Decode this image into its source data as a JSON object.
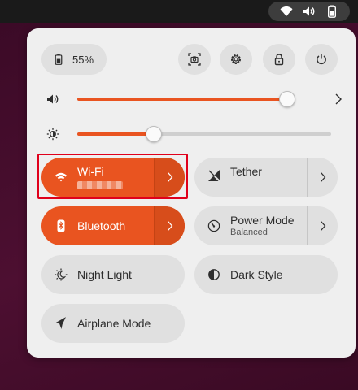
{
  "topbar": {
    "tray_icons": [
      "wifi-icon",
      "volume-icon",
      "battery-icon"
    ]
  },
  "quick_settings": {
    "battery": {
      "label": "55%",
      "icon": "battery-icon",
      "level_percent": 55
    },
    "round_buttons": [
      {
        "name": "screenshot-button",
        "icon": "screenshot-icon"
      },
      {
        "name": "settings-button",
        "icon": "gear-icon"
      },
      {
        "name": "lock-button",
        "icon": "lock-icon"
      },
      {
        "name": "power-button",
        "icon": "power-icon"
      }
    ],
    "volume": {
      "icon": "volume-icon",
      "level_percent": 100
    },
    "brightness": {
      "icon": "brightness-icon",
      "level_percent": 30
    },
    "tiles": {
      "wifi": {
        "title": "Wi-Fi",
        "subtitle_redacted": true,
        "active": true
      },
      "tether": {
        "title": "Tether",
        "active": false
      },
      "bluetooth": {
        "title": "Bluetooth",
        "active": true
      },
      "power_mode": {
        "title": "Power Mode",
        "subtitle": "Balanced",
        "active": false
      },
      "night_light": {
        "title": "Night Light",
        "active": false
      },
      "dark_style": {
        "title": "Dark Style",
        "active": false
      },
      "airplane_mode": {
        "title": "Airplane Mode",
        "active": false
      }
    }
  },
  "colors": {
    "accent": "#e95420",
    "accent_dark": "#d74d1b",
    "panel_bg": "#efefef",
    "tile_bg": "#e0e0e0",
    "highlight": "#e0001b"
  }
}
